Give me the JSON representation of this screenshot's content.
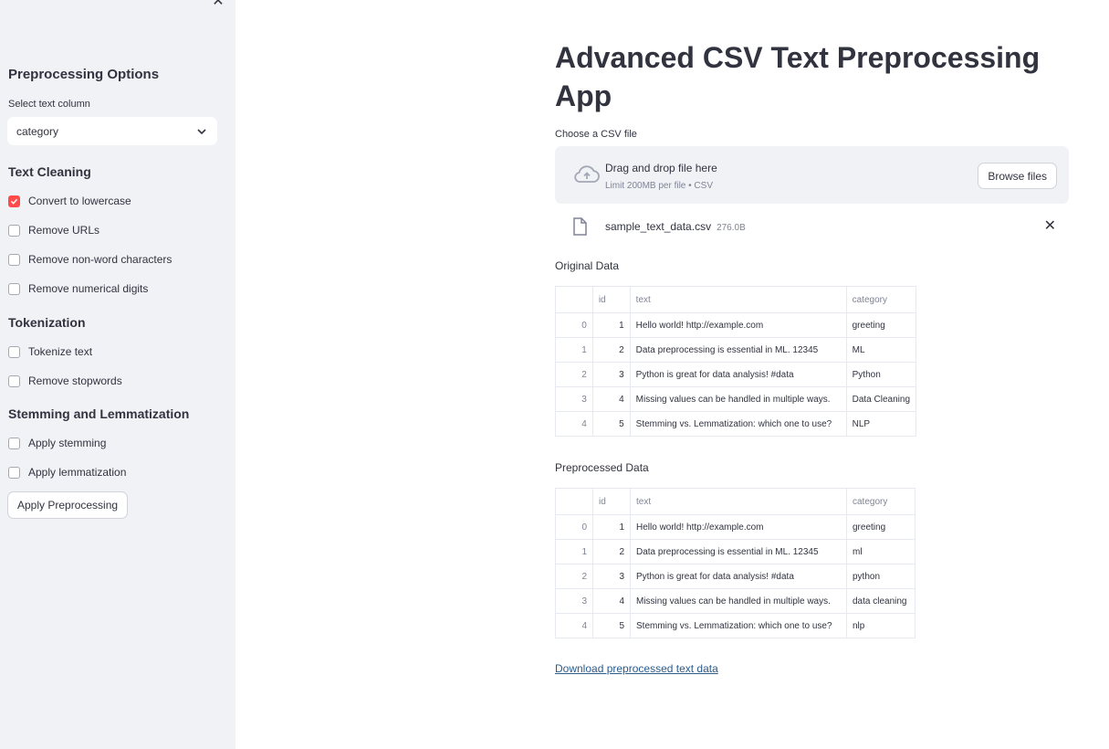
{
  "sidebar": {
    "close_symbol": "✕",
    "heading": "Preprocessing Options",
    "select_label": "Select text column",
    "select_value": "category",
    "sections": {
      "text_cleaning": "Text Cleaning",
      "tokenization": "Tokenization",
      "stemming": "Stemming and Lemmatization"
    },
    "options": {
      "lowercase": {
        "label": "Convert to lowercase",
        "checked": true
      },
      "urls": {
        "label": "Remove URLs",
        "checked": false
      },
      "nonword": {
        "label": "Remove non-word characters",
        "checked": false
      },
      "digits": {
        "label": "Remove numerical digits",
        "checked": false
      },
      "tokenize": {
        "label": "Tokenize text",
        "checked": false
      },
      "stopwords": {
        "label": "Remove stopwords",
        "checked": false
      },
      "stemming": {
        "label": "Apply stemming",
        "checked": false
      },
      "lemmatization": {
        "label": "Apply lemmatization",
        "checked": false
      }
    },
    "apply_button": "Apply Preprocessing"
  },
  "main": {
    "title": "Advanced CSV Text Preprocessing App",
    "uploader_label": "Choose a CSV file",
    "drag_text": "Drag and drop file here",
    "limit_text": "Limit 200MB per file • CSV",
    "browse_button": "Browse files",
    "file_name": "sample_text_data.csv",
    "file_size": "276.0B",
    "file_close": "✕",
    "original_label": "Original Data",
    "preprocessed_label": "Preprocessed Data",
    "download_link": "Download preprocessed text data"
  },
  "columns": [
    "",
    "id",
    "text",
    "category"
  ],
  "original_rows": [
    [
      "0",
      "1",
      "Hello world! http://example.com",
      "greeting"
    ],
    [
      "1",
      "2",
      "Data preprocessing is essential in ML. 12345",
      "ML"
    ],
    [
      "2",
      "3",
      "Python is great for data analysis! #data",
      "Python"
    ],
    [
      "3",
      "4",
      "Missing values can be handled in multiple ways.",
      "Data Cleaning"
    ],
    [
      "4",
      "5",
      "Stemming vs. Lemmatization: which one to use?",
      "NLP"
    ]
  ],
  "preprocessed_rows": [
    [
      "0",
      "1",
      "Hello world! http://example.com",
      "greeting"
    ],
    [
      "1",
      "2",
      "Data preprocessing is essential in ML. 12345",
      "ml"
    ],
    [
      "2",
      "3",
      "Python is great for data analysis! #data",
      "python"
    ],
    [
      "3",
      "4",
      "Missing values can be handled in multiple ways.",
      "data cleaning"
    ],
    [
      "4",
      "5",
      "Stemming vs. Lemmatization: which one to use?",
      "nlp"
    ]
  ],
  "colors": {
    "accent": "#ff4b4b",
    "sidebar_bg": "#f0f2f6",
    "link": "#2a5b8c"
  },
  "icons": {
    "close": "close-icon",
    "dropdown": "chevron-down-icon",
    "upload": "cloud-upload-icon",
    "file": "file-icon",
    "check": "check-icon"
  }
}
